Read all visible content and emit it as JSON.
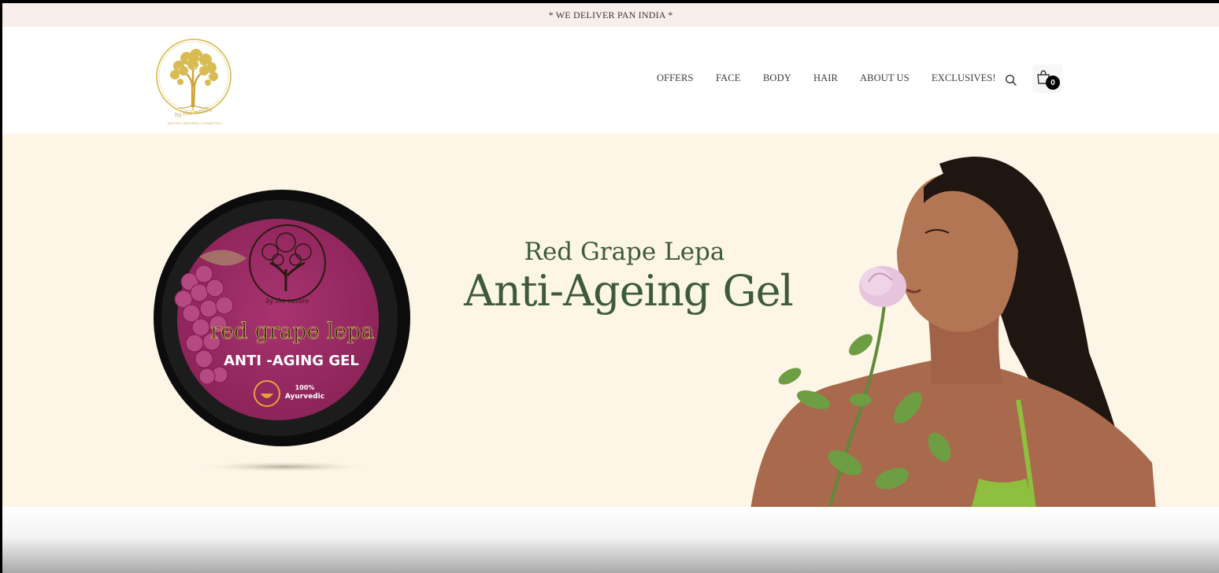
{
  "announcement": "* WE DELIVER PAN INDIA *",
  "logo": {
    "brand_text": "by the nature",
    "tagline": "NATURE INSPIRED COSMETICS"
  },
  "nav": {
    "items": [
      "OFFERS",
      "FACE",
      "BODY",
      "HAIR",
      "ABOUT US",
      "EXCLUSIVES!"
    ]
  },
  "icons": {
    "search": "search-icon",
    "cart": "shopping-bag-icon"
  },
  "cart": {
    "count": "0"
  },
  "hero": {
    "subtitle": "Red Grape Lepa",
    "title": "Anti-Ageing Gel",
    "product_label": {
      "brand": "by the nature",
      "name": "red grape lepa",
      "type": "ANTI -AGING GEL",
      "badge_line1": "100%",
      "badge_line2": "Ayurvedic"
    },
    "background_color": "#fdf5e6",
    "text_color": "#3d5a3c"
  },
  "colors": {
    "announcement_bg": "#f8eeec",
    "logo_gold": "#c8a640",
    "jar_label": "#9a2a63"
  }
}
